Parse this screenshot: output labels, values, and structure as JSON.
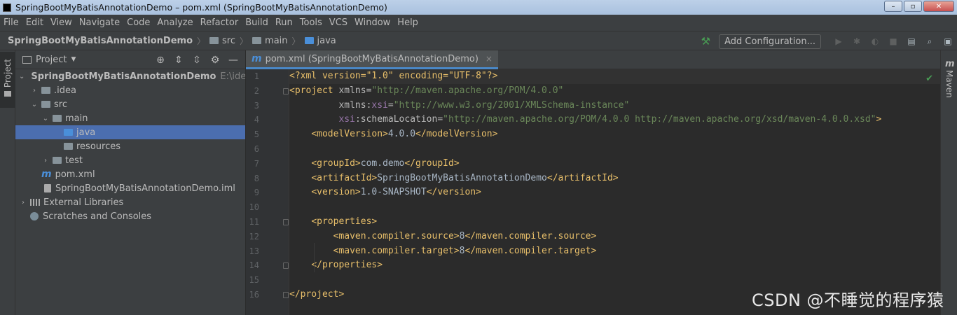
{
  "window": {
    "title": "SpringBootMyBatisAnnotationDemo – pom.xml (SpringBootMyBatisAnnotationDemo)",
    "controls": [
      "–",
      "▫",
      "✕"
    ]
  },
  "menu": [
    "File",
    "Edit",
    "View",
    "Navigate",
    "Code",
    "Analyze",
    "Refactor",
    "Build",
    "Run",
    "Tools",
    "VCS",
    "Window",
    "Help"
  ],
  "breadcrumb": {
    "project": "SpringBootMyBatisAnnotationDemo",
    "items": [
      "src",
      "main",
      "java"
    ]
  },
  "toolbar": {
    "add_config_label": "Add Configuration..."
  },
  "sidebar": {
    "left_tab_label": "Project",
    "right_tab_label": "Maven"
  },
  "project_panel": {
    "title": "Project",
    "tree": [
      {
        "label": "SpringBootMyBatisAnnotationDemo",
        "path": "E:\\idea-wo"
      },
      {
        "label": ".idea"
      },
      {
        "label": "src"
      },
      {
        "label": "main"
      },
      {
        "label": "java"
      },
      {
        "label": "resources"
      },
      {
        "label": "test"
      },
      {
        "label": "pom.xml"
      },
      {
        "label": "SpringBootMyBatisAnnotationDemo.iml"
      },
      {
        "label": "External Libraries"
      },
      {
        "label": "Scratches and Consoles"
      }
    ]
  },
  "editor": {
    "tab_label": "pom.xml (SpringBootMyBatisAnnotationDemo)",
    "line_numbers": [
      "1",
      "2",
      "3",
      "4",
      "5",
      "6",
      "7",
      "8",
      "9",
      "10",
      "11",
      "12",
      "13",
      "14",
      "15",
      "16"
    ],
    "code": {
      "l1_pi": "<?xml version=\"1.0\" encoding=\"UTF-8\"?>",
      "l2_open": "<project ",
      "l2_attr": "xmlns=",
      "l2_val": "\"http://maven.apache.org/POM/4.0.0\"",
      "l3_indent": "         ",
      "l3_attr": "xmlns:",
      "l3_ns": "xsi",
      "l3_eq": "=",
      "l3_val": "\"http://www.w3.org/2001/XMLSchema-instance\"",
      "l4_indent": "         ",
      "l4_ns": "xsi",
      "l4_attr": ":schemaLocation=",
      "l4_val": "\"http://maven.apache.org/POM/4.0.0 http://maven.apache.org/xsd/maven-4.0.0.xsd\"",
      "l4_close": ">",
      "l5_indent": "    ",
      "l5_open": "<modelVersion>",
      "l5_text": "4.0.0",
      "l5_close": "</modelVersion>",
      "l7_indent": "    ",
      "l7_open": "<groupId>",
      "l7_text": "com.demo",
      "l7_close": "</groupId>",
      "l8_indent": "    ",
      "l8_open": "<artifactId>",
      "l8_text": "SpringBootMyBatisAnnotationDemo",
      "l8_close": "</artifactId>",
      "l9_indent": "    ",
      "l9_open": "<version>",
      "l9_text": "1.0-SNAPSHOT",
      "l9_close": "</version>",
      "l11_indent": "    ",
      "l11_open": "<properties>",
      "l12_indent": "        ",
      "l12_open": "<maven.compiler.source>",
      "l12_text": "8",
      "l12_close": "</maven.compiler.source>",
      "l13_indent": "        ",
      "l13_open": "<maven.compiler.target>",
      "l13_text": "8",
      "l13_close": "</maven.compiler.target>",
      "l14_indent": "    ",
      "l14_close": "</properties>",
      "l16_close": "</project>"
    }
  },
  "watermark": "CSDN @不睡觉的程序猿"
}
